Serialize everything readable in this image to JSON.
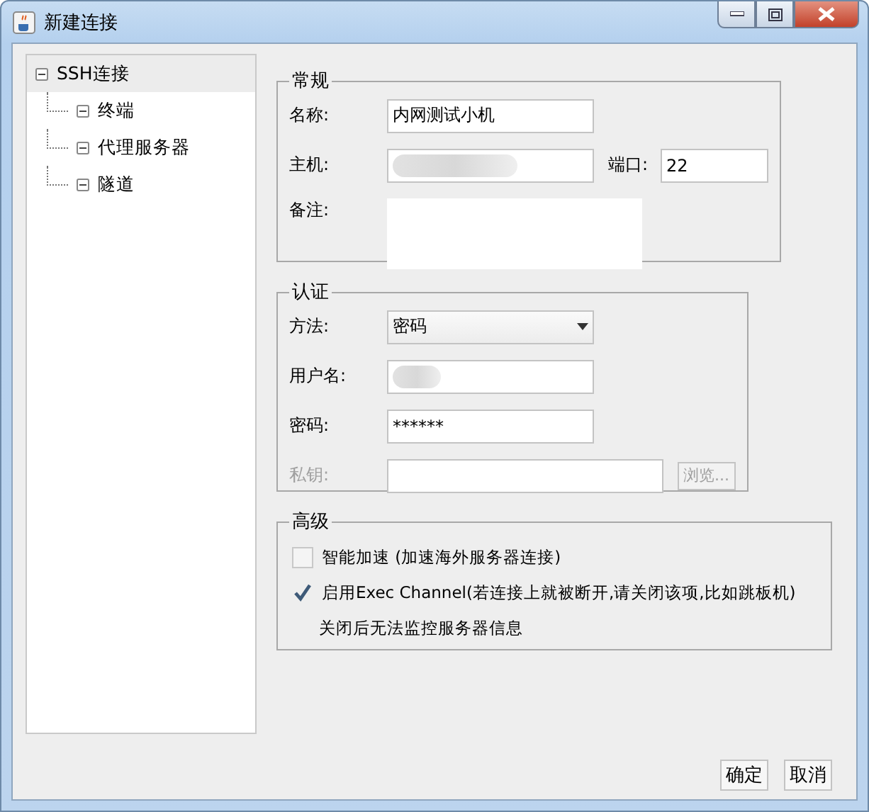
{
  "window": {
    "title": "新建连接"
  },
  "tree": {
    "items": [
      {
        "label": "SSH连接",
        "selected": true,
        "expanded": true,
        "children": [
          {
            "label": "终端",
            "selected": false,
            "expanded": true
          },
          {
            "label": "代理服务器",
            "selected": false,
            "expanded": true
          },
          {
            "label": "隧道",
            "selected": false,
            "expanded": true
          }
        ]
      }
    ]
  },
  "general": {
    "title": "常规",
    "name": {
      "label": "名称:",
      "value": "内网测试小机"
    },
    "host": {
      "label": "主机:",
      "redacted": true
    },
    "port": {
      "label": "端口:",
      "value": "22"
    },
    "note": {
      "label": "备注:"
    }
  },
  "auth": {
    "title": "认证",
    "method": {
      "label": "方法:",
      "value": "密码"
    },
    "username": {
      "label": "用户名:",
      "redacted": true
    },
    "password": {
      "label": "密码:",
      "value": "******"
    },
    "private_key": {
      "label": "私钥:",
      "disabled": true
    },
    "browse_button": {
      "label": "浏览...",
      "disabled": true
    }
  },
  "advanced": {
    "title": "高级",
    "options": [
      {
        "label": "智能加速 (加速海外服务器连接)",
        "checked": false
      },
      {
        "label": "启用Exec Channel(若连接上就被断开,请关闭该项,比如跳板机)",
        "checked": true
      }
    ],
    "note": "关闭后无法监控服务器信息"
  },
  "buttons": [
    "确定",
    "取消"
  ]
}
